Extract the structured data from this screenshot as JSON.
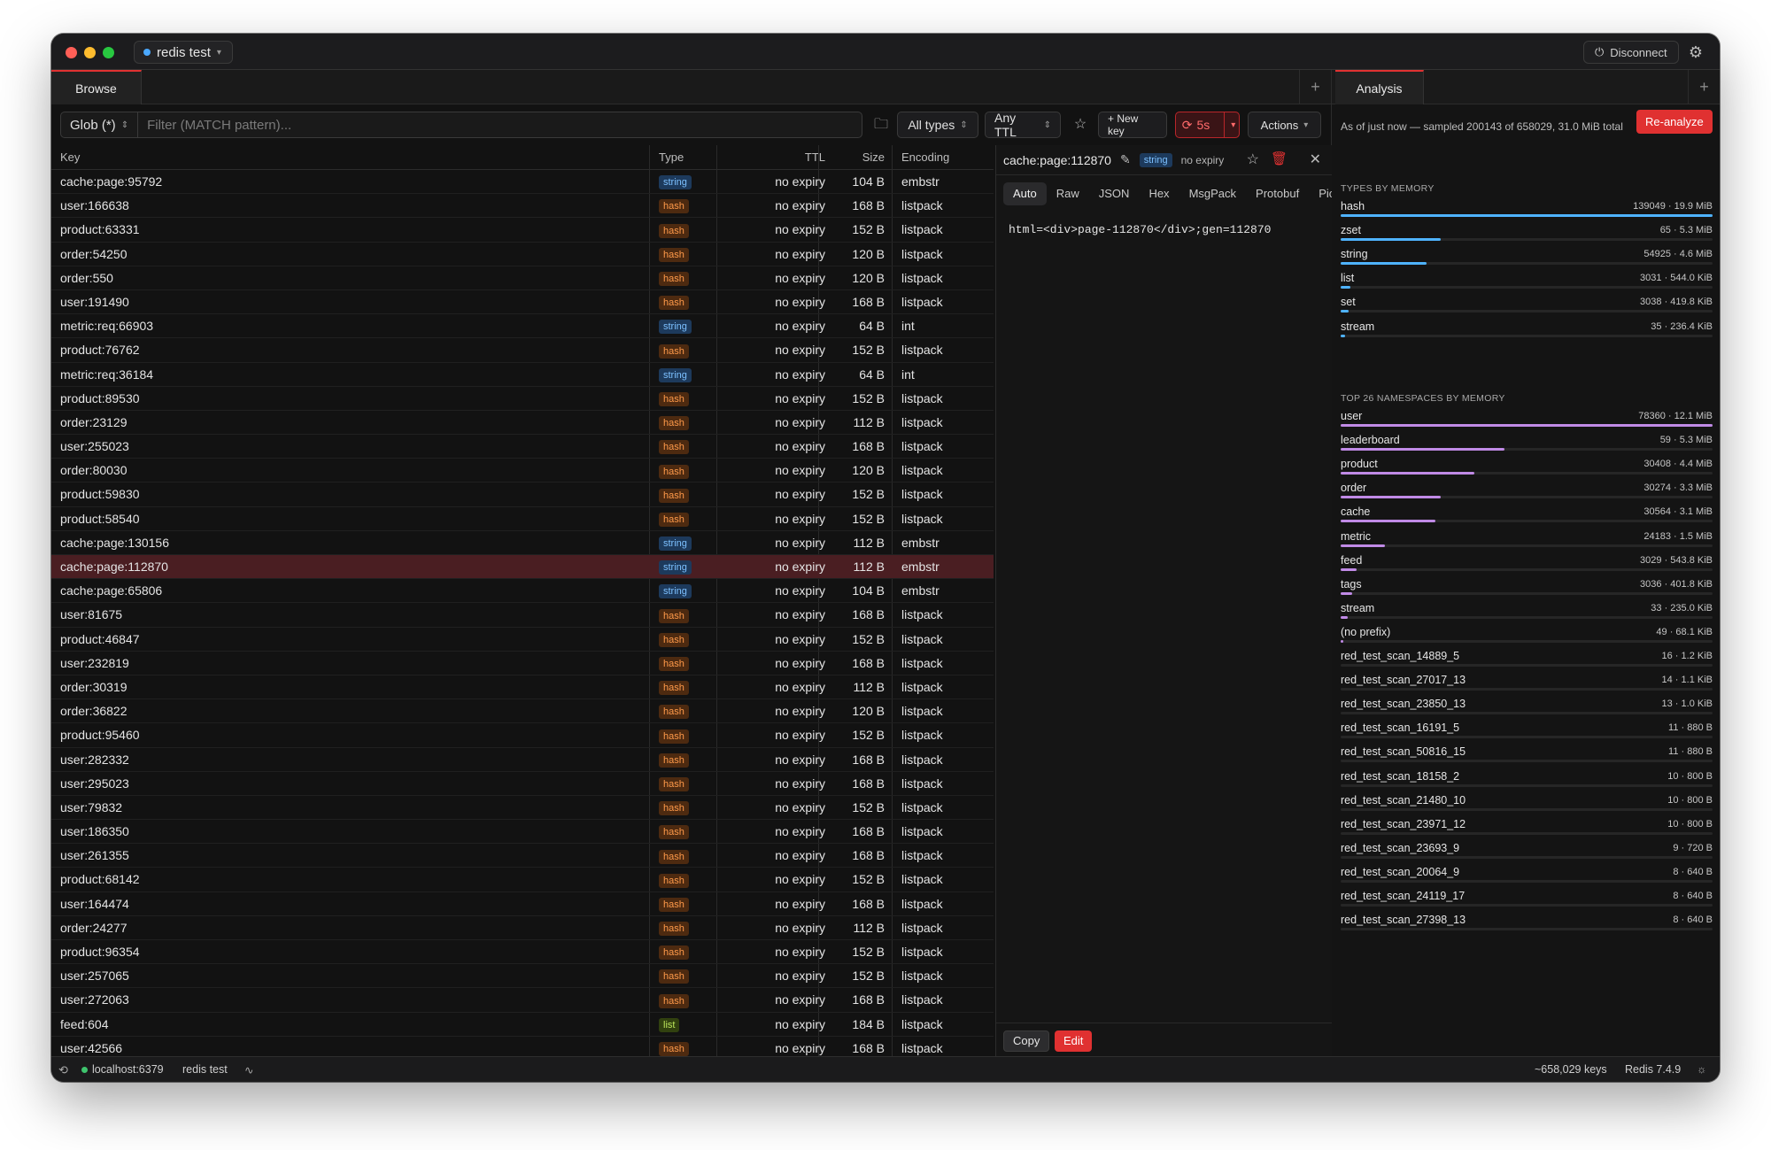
{
  "titlebar": {
    "connection_name": "redis test",
    "disconnect_label": "Disconnect"
  },
  "left": {
    "tab_label": "Browse",
    "glob_label": "Glob (*)",
    "filter_placeholder": "Filter (MATCH pattern)...",
    "type_filter": "All types",
    "ttl_filter": "Any TTL",
    "new_key_label": "+ New key",
    "refresh_interval": "5s",
    "actions_label": "Actions"
  },
  "table": {
    "headers": {
      "key": "Key",
      "type": "Type",
      "ttl": "TTL",
      "size": "Size",
      "encoding": "Encoding"
    },
    "rows": [
      {
        "key": "cache:page:95792",
        "type": "string",
        "ttl": "no expiry",
        "size": "104 B",
        "enc": "embstr"
      },
      {
        "key": "user:166638",
        "type": "hash",
        "ttl": "no expiry",
        "size": "168 B",
        "enc": "listpack"
      },
      {
        "key": "product:63331",
        "type": "hash",
        "ttl": "no expiry",
        "size": "152 B",
        "enc": "listpack"
      },
      {
        "key": "order:54250",
        "type": "hash",
        "ttl": "no expiry",
        "size": "120 B",
        "enc": "listpack"
      },
      {
        "key": "order:550",
        "type": "hash",
        "ttl": "no expiry",
        "size": "120 B",
        "enc": "listpack"
      },
      {
        "key": "user:191490",
        "type": "hash",
        "ttl": "no expiry",
        "size": "168 B",
        "enc": "listpack"
      },
      {
        "key": "metric:req:66903",
        "type": "string",
        "ttl": "no expiry",
        "size": "64 B",
        "enc": "int"
      },
      {
        "key": "product:76762",
        "type": "hash",
        "ttl": "no expiry",
        "size": "152 B",
        "enc": "listpack"
      },
      {
        "key": "metric:req:36184",
        "type": "string",
        "ttl": "no expiry",
        "size": "64 B",
        "enc": "int"
      },
      {
        "key": "product:89530",
        "type": "hash",
        "ttl": "no expiry",
        "size": "152 B",
        "enc": "listpack"
      },
      {
        "key": "order:23129",
        "type": "hash",
        "ttl": "no expiry",
        "size": "112 B",
        "enc": "listpack"
      },
      {
        "key": "user:255023",
        "type": "hash",
        "ttl": "no expiry",
        "size": "168 B",
        "enc": "listpack"
      },
      {
        "key": "order:80030",
        "type": "hash",
        "ttl": "no expiry",
        "size": "120 B",
        "enc": "listpack"
      },
      {
        "key": "product:59830",
        "type": "hash",
        "ttl": "no expiry",
        "size": "152 B",
        "enc": "listpack"
      },
      {
        "key": "product:58540",
        "type": "hash",
        "ttl": "no expiry",
        "size": "152 B",
        "enc": "listpack"
      },
      {
        "key": "cache:page:130156",
        "type": "string",
        "ttl": "no expiry",
        "size": "112 B",
        "enc": "embstr"
      },
      {
        "key": "cache:page:112870",
        "type": "string",
        "ttl": "no expiry",
        "size": "112 B",
        "enc": "embstr",
        "selected": true
      },
      {
        "key": "cache:page:65806",
        "type": "string",
        "ttl": "no expiry",
        "size": "104 B",
        "enc": "embstr"
      },
      {
        "key": "user:81675",
        "type": "hash",
        "ttl": "no expiry",
        "size": "168 B",
        "enc": "listpack"
      },
      {
        "key": "product:46847",
        "type": "hash",
        "ttl": "no expiry",
        "size": "152 B",
        "enc": "listpack"
      },
      {
        "key": "user:232819",
        "type": "hash",
        "ttl": "no expiry",
        "size": "168 B",
        "enc": "listpack"
      },
      {
        "key": "order:30319",
        "type": "hash",
        "ttl": "no expiry",
        "size": "112 B",
        "enc": "listpack"
      },
      {
        "key": "order:36822",
        "type": "hash",
        "ttl": "no expiry",
        "size": "120 B",
        "enc": "listpack"
      },
      {
        "key": "product:95460",
        "type": "hash",
        "ttl": "no expiry",
        "size": "152 B",
        "enc": "listpack"
      },
      {
        "key": "user:282332",
        "type": "hash",
        "ttl": "no expiry",
        "size": "168 B",
        "enc": "listpack"
      },
      {
        "key": "user:295023",
        "type": "hash",
        "ttl": "no expiry",
        "size": "168 B",
        "enc": "listpack"
      },
      {
        "key": "user:79832",
        "type": "hash",
        "ttl": "no expiry",
        "size": "152 B",
        "enc": "listpack"
      },
      {
        "key": "user:186350",
        "type": "hash",
        "ttl": "no expiry",
        "size": "168 B",
        "enc": "listpack"
      },
      {
        "key": "user:261355",
        "type": "hash",
        "ttl": "no expiry",
        "size": "168 B",
        "enc": "listpack"
      },
      {
        "key": "product:68142",
        "type": "hash",
        "ttl": "no expiry",
        "size": "152 B",
        "enc": "listpack"
      },
      {
        "key": "user:164474",
        "type": "hash",
        "ttl": "no expiry",
        "size": "168 B",
        "enc": "listpack"
      },
      {
        "key": "order:24277",
        "type": "hash",
        "ttl": "no expiry",
        "size": "112 B",
        "enc": "listpack"
      },
      {
        "key": "product:96354",
        "type": "hash",
        "ttl": "no expiry",
        "size": "152 B",
        "enc": "listpack"
      },
      {
        "key": "user:257065",
        "type": "hash",
        "ttl": "no expiry",
        "size": "152 B",
        "enc": "listpack"
      },
      {
        "key": "user:272063",
        "type": "hash",
        "ttl": "no expiry",
        "size": "168 B",
        "enc": "listpack"
      },
      {
        "key": "feed:604",
        "type": "list",
        "ttl": "no expiry",
        "size": "184 B",
        "enc": "listpack"
      },
      {
        "key": "user:42566",
        "type": "hash",
        "ttl": "no expiry",
        "size": "168 B",
        "enc": "listpack"
      }
    ]
  },
  "detail": {
    "key": "cache:page:112870",
    "type": "string",
    "ttl": "no expiry",
    "tabs": [
      "Auto",
      "Raw",
      "JSON",
      "Hex",
      "MsgPack",
      "Protobuf",
      "Pic"
    ],
    "value": "html=<div>page-112870</div>;gen=112870",
    "copy_label": "Copy",
    "edit_label": "Edit"
  },
  "analysis": {
    "tab_label": "Analysis",
    "as_of": "As of just now — sampled 200143 of 658029, 31.0 MiB total",
    "reanalyze_label": "Re-analyze",
    "types_title": "TYPES BY MEMORY",
    "types": [
      {
        "name": "hash",
        "value": "139049 · 19.9 MiB",
        "pct": 1.0
      },
      {
        "name": "zset",
        "value": "65 · 5.3 MiB",
        "pct": 0.27
      },
      {
        "name": "string",
        "value": "54925 · 4.6 MiB",
        "pct": 0.23
      },
      {
        "name": "list",
        "value": "3031 · 544.0 KiB",
        "pct": 0.027
      },
      {
        "name": "set",
        "value": "3038 · 419.8 KiB",
        "pct": 0.021
      },
      {
        "name": "stream",
        "value": "35 · 236.4 KiB",
        "pct": 0.012
      }
    ],
    "ns_title": "TOP 26 NAMESPACES BY MEMORY",
    "namespaces": [
      {
        "name": "user",
        "value": "78360 · 12.1 MiB",
        "pct": 1.0
      },
      {
        "name": "leaderboard",
        "value": "59 · 5.3 MiB",
        "pct": 0.44
      },
      {
        "name": "product",
        "value": "30408 · 4.4 MiB",
        "pct": 0.36
      },
      {
        "name": "order",
        "value": "30274 · 3.3 MiB",
        "pct": 0.27
      },
      {
        "name": "cache",
        "value": "30564 · 3.1 MiB",
        "pct": 0.255
      },
      {
        "name": "metric",
        "value": "24183 · 1.5 MiB",
        "pct": 0.12
      },
      {
        "name": "feed",
        "value": "3029 · 543.8 KiB",
        "pct": 0.044
      },
      {
        "name": "tags",
        "value": "3036 · 401.8 KiB",
        "pct": 0.032
      },
      {
        "name": "stream",
        "value": "33 · 235.0 KiB",
        "pct": 0.019
      },
      {
        "name": "(no prefix)",
        "value": "49 · 68.1 KiB",
        "pct": 0.006
      },
      {
        "name": "red_test_scan_14889_5",
        "value": "16 · 1.2 KiB",
        "pct": 0.0
      },
      {
        "name": "red_test_scan_27017_13",
        "value": "14 · 1.1 KiB",
        "pct": 0.0
      },
      {
        "name": "red_test_scan_23850_13",
        "value": "13 · 1.0 KiB",
        "pct": 0.0
      },
      {
        "name": "red_test_scan_16191_5",
        "value": "11 · 880 B",
        "pct": 0.0
      },
      {
        "name": "red_test_scan_50816_15",
        "value": "11 · 880 B",
        "pct": 0.0
      },
      {
        "name": "red_test_scan_18158_2",
        "value": "10 · 800 B",
        "pct": 0.0
      },
      {
        "name": "red_test_scan_21480_10",
        "value": "10 · 800 B",
        "pct": 0.0
      },
      {
        "name": "red_test_scan_23971_12",
        "value": "10 · 800 B",
        "pct": 0.0
      },
      {
        "name": "red_test_scan_23693_9",
        "value": "9 · 720 B",
        "pct": 0.0
      },
      {
        "name": "red_test_scan_20064_9",
        "value": "8 · 640 B",
        "pct": 0.0
      },
      {
        "name": "red_test_scan_24119_17",
        "value": "8 · 640 B",
        "pct": 0.0
      },
      {
        "name": "red_test_scan_27398_13",
        "value": "8 · 640 B",
        "pct": 0.0
      }
    ]
  },
  "statusbar": {
    "host": "localhost:6379",
    "connection": "redis test",
    "keys": "~658,029 keys",
    "version": "Redis 7.4.9"
  },
  "colors": {
    "accent": "#e03131",
    "types_bar": "#4fb3ff",
    "ns_bar": "#c08ae6"
  }
}
